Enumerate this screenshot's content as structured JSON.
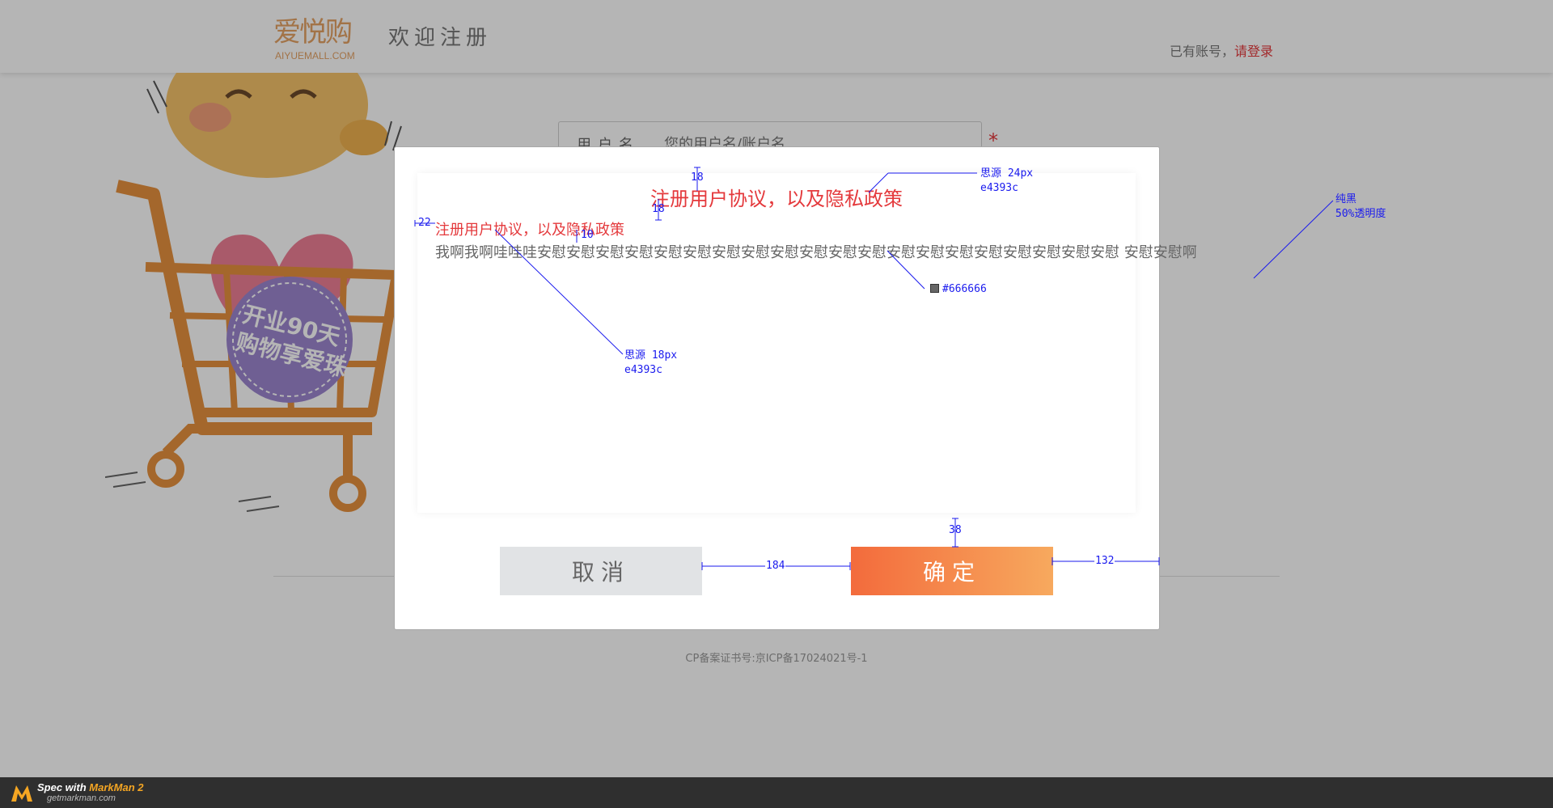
{
  "header": {
    "logo_text": "爱悦购",
    "logo_sub": "AIYUEMALL.COM",
    "title": "欢迎注册",
    "login_prompt": "已有账号，",
    "login_link": "请登录"
  },
  "form": {
    "username_label": "用户名",
    "username_placeholder": "您的用户名/账户名"
  },
  "mascot": {
    "badge_line1": "开业90天",
    "badge_line2": "购物享爱珠"
  },
  "footer": {
    "icp": "CP备案证书号:京ICP备17024021号-1"
  },
  "modal": {
    "title": "注册用户协议，以及隐私政策",
    "subtitle": "注册用户协议，以及隐私政策",
    "body": "我啊我啊哇哇哇安慰安慰安慰安慰安慰安慰安慰安慰安慰安慰安慰安慰安慰安慰安慰安慰安慰安慰安慰安慰    安慰安慰啊",
    "cancel_label": "取消",
    "confirm_label": "确定"
  },
  "annotations": {
    "title_font": "思源  24px",
    "title_color": "e4393c",
    "subtitle_font": "思源 18px",
    "subtitle_color": "e4393c",
    "body_color": "#666666",
    "overlay_note_1": "纯黑",
    "overlay_note_2": "50%透明度",
    "gap_title_top": "18",
    "gap_title_sub": "18",
    "gap_sub_left": "22",
    "gap_sub_body": "10",
    "gap_box_buttons": "38",
    "gap_buttons": "184",
    "gap_right": "132"
  },
  "markman": {
    "spec_prefix": "Spec with ",
    "brand": "MarkMan 2",
    "site": "getmarkman.com"
  },
  "colors": {
    "accent": "#e4393c",
    "body_text": "#666666",
    "logo": "#e4a265",
    "confirm_gradient_start": "#f36b3c",
    "confirm_gradient_end": "#f7a95e"
  }
}
